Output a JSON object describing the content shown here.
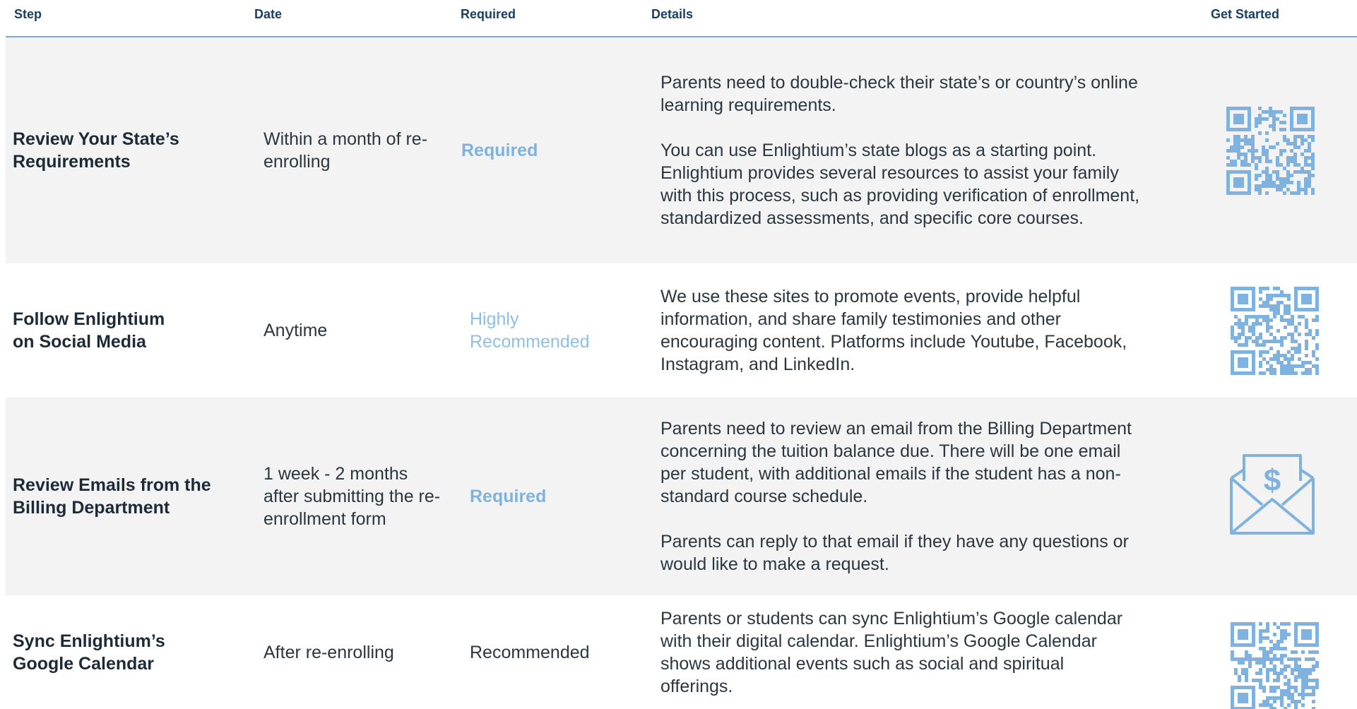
{
  "header": {
    "step": "Step",
    "date": "Date",
    "required": "Required",
    "details": "Details",
    "get_started": "Get Started"
  },
  "rows": [
    {
      "step": "Review Your State’s Requirements",
      "date": "Within a month of re-enrolling",
      "required": "Required",
      "details": [
        "Parents need to double-check their state’s or country’s online learning requirements.",
        "You can use Enlightium’s state blogs as a starting point. Enlightium provides several resources to assist your family with this process, such as providing verification of enrollment, standardized assessments, and specific core courses."
      ],
      "get_started_icon": "qr-code-icon"
    },
    {
      "step": "Follow Enlightium on Social Media",
      "date": "Anytime",
      "required": "Highly Recommended",
      "details": [
        "We use these sites to promote events, provide helpful information, and share family testimonies and other encouraging content. Platforms include Youtube, Facebook, Instagram, and LinkedIn."
      ],
      "get_started_icon": "qr-code-icon"
    },
    {
      "step": "Review Emails from the Billing Department",
      "date": "1 week - 2 months after submitting the re-enrollment form",
      "required": "Required",
      "details": [
        "Parents need to review an email from the Billing Department concerning the tuition balance due. There will be one email per student, with additional emails if the student has a non-standard course schedule.",
        "Parents can reply to that email if they have any questions or would like to make a request."
      ],
      "get_started_icon": "dollar-envelope-icon"
    },
    {
      "step": "Sync Enlightium’s Google Calendar",
      "date": "After re-enrolling",
      "required": "Recommended",
      "details": [
        "Parents or students can sync Enlightium’s Google calendar with their digital calendar. Enlightium’s Google Calendar shows additional events such as social and spiritual offerings."
      ],
      "get_started_icon": "qr-code-icon"
    }
  ],
  "colors": {
    "accent": "#7fb2de",
    "header_text": "#1b3f63",
    "row_shade": "#f3f3f3",
    "rule": "#79a9d4"
  }
}
